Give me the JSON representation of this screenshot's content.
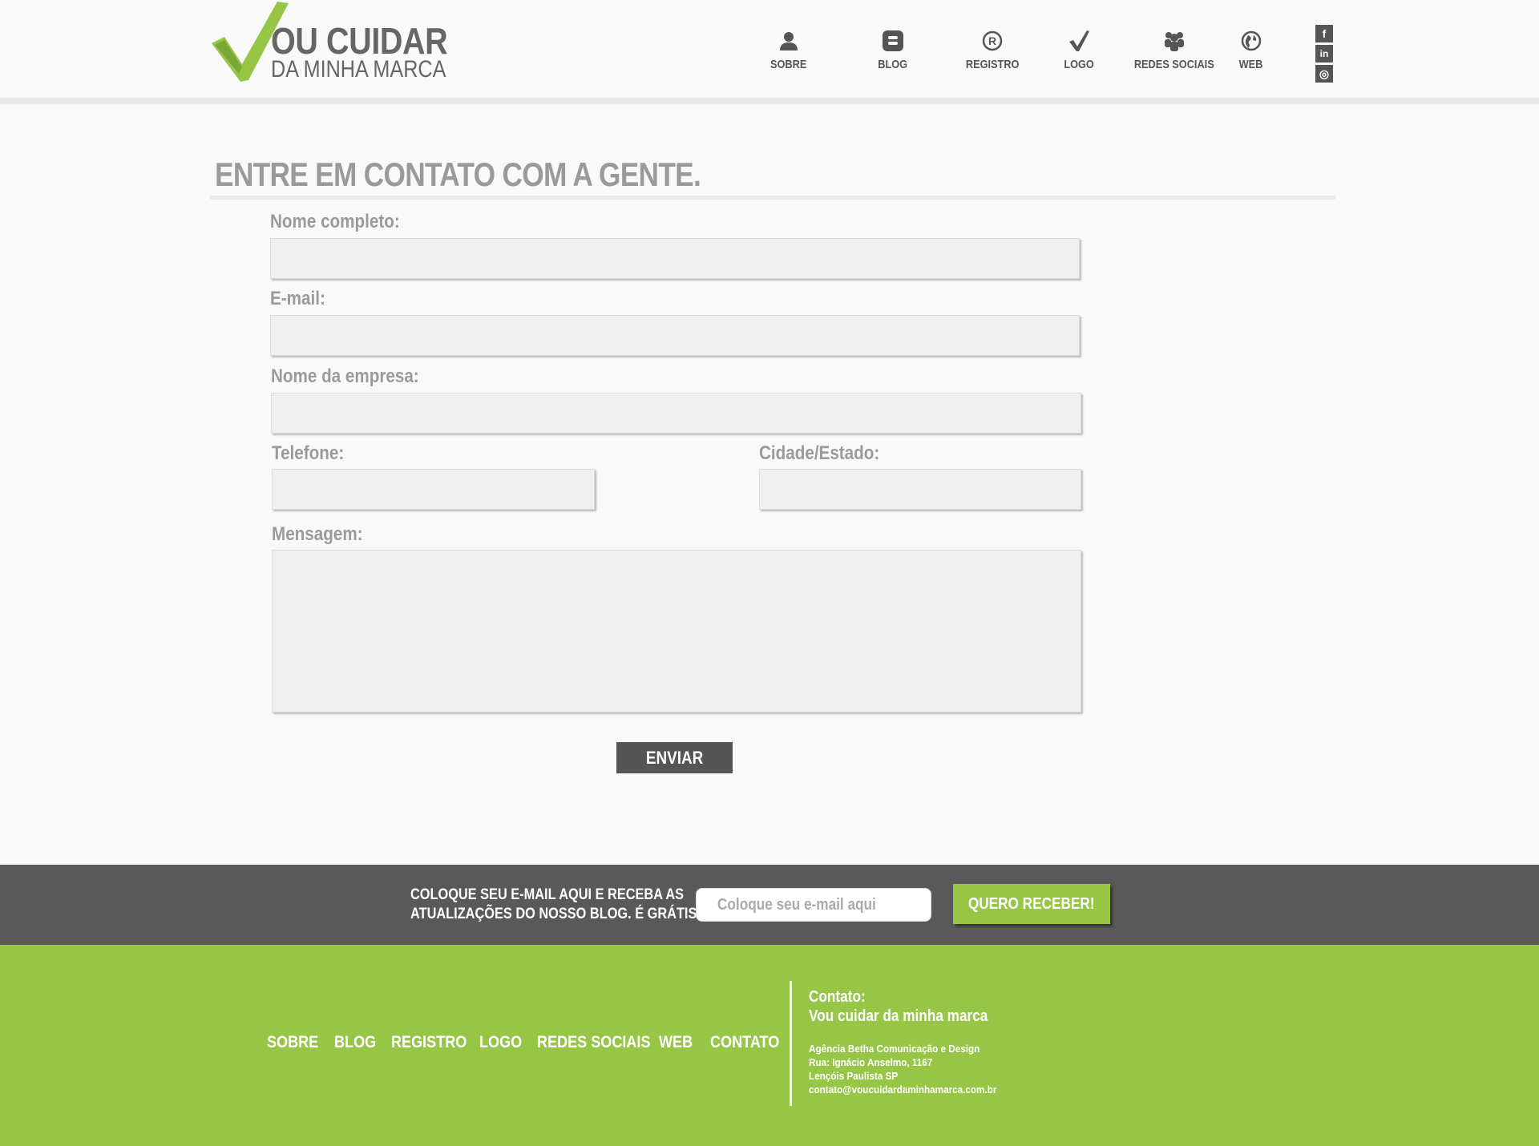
{
  "brand": {
    "title": "OU CUIDAR",
    "subtitle": "DA MINHA MARCA",
    "green": "#97c647",
    "dark": "#595959"
  },
  "nav": [
    {
      "label": "SOBRE",
      "icon": "person-icon"
    },
    {
      "label": "BLOG",
      "icon": "blogger-icon"
    },
    {
      "label": "REGISTRO",
      "icon": "registered-icon"
    },
    {
      "label": "LOGO",
      "icon": "check-icon"
    },
    {
      "label": "REDES SOCIAIS",
      "icon": "group-icon"
    },
    {
      "label": "WEB",
      "icon": "globe-icon"
    }
  ],
  "social": [
    {
      "icon": "facebook-icon",
      "glyph": "f"
    },
    {
      "icon": "linkedin-icon",
      "glyph": "in"
    },
    {
      "icon": "instagram-icon",
      "glyph": "◎"
    }
  ],
  "main": {
    "title": "ENTRE EM CONTATO COM A GENTE.",
    "form": {
      "name_label": "Nome completo:",
      "email_label": "E-mail:",
      "company_label": "Nome da empresa:",
      "phone_label": "Telefone:",
      "city_label": "Cidade/Estado:",
      "message_label": "Mensagem:",
      "submit_label": "ENVIAR"
    }
  },
  "newsletter": {
    "text_line1": "COLOQUE SEU E-MAIL AQUI E RECEBA AS",
    "text_line2": "ATUALIZAÇÕES DO NOSSO BLOG. É GRÁTIS!",
    "placeholder": "Coloque seu e-mail aqui",
    "button": "QUERO RECEBER!"
  },
  "footer": {
    "nav": [
      "SOBRE",
      "BLOG",
      "REGISTRO",
      "LOGO",
      "REDES SOCIAIS",
      "WEB",
      "CONTATO"
    ],
    "contact_title_1": "Contato:",
    "contact_title_2": "Vou cuidar da minha marca",
    "address": [
      "Agência Betha Comunicação e Design",
      "Rua: Ignácio Anselmo, 1167",
      "Lençóis Paulista SP",
      "contato@voucuidardaminhamarca.com.br"
    ]
  }
}
